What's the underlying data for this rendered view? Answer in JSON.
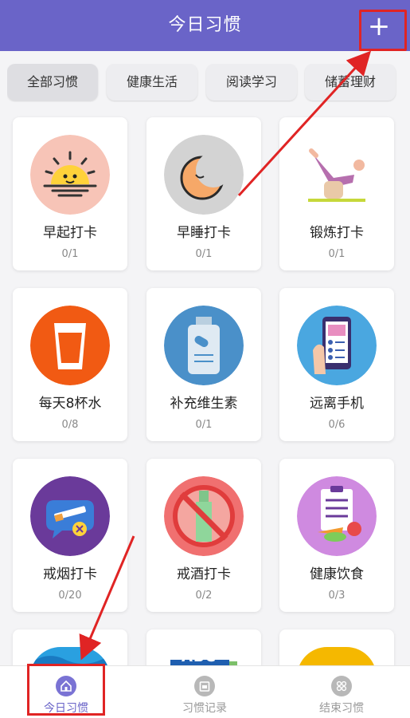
{
  "header": {
    "title": "今日习惯",
    "add_label": "+"
  },
  "tabs": [
    {
      "label": "全部习惯",
      "active": true
    },
    {
      "label": "健康生活",
      "active": false
    },
    {
      "label": "阅读学习",
      "active": false
    },
    {
      "label": "储蓄理财",
      "active": false
    }
  ],
  "habits": [
    {
      "name": "早起打卡",
      "progress": "0/1",
      "icon": "sunrise-icon",
      "color": "#f7c4b7"
    },
    {
      "name": "早睡打卡",
      "progress": "0/1",
      "icon": "moon-icon",
      "color": "#d3d3d3"
    },
    {
      "name": "锻炼打卡",
      "progress": "0/1",
      "icon": "yoga-icon",
      "color": "#ffffff"
    },
    {
      "name": "每天8杯水",
      "progress": "0/8",
      "icon": "water-glass-icon",
      "color": "#f15a13"
    },
    {
      "name": "补充维生素",
      "progress": "0/1",
      "icon": "vitamin-bottle-icon",
      "color": "#4a90c9"
    },
    {
      "name": "远离手机",
      "progress": "0/6",
      "icon": "phone-icon",
      "color": "#4aa7e0"
    },
    {
      "name": "戒烟打卡",
      "progress": "0/20",
      "icon": "no-smoking-icon",
      "color": "#6a3a9a"
    },
    {
      "name": "戒酒打卡",
      "progress": "0/2",
      "icon": "no-alcohol-icon",
      "color": "#f07070"
    },
    {
      "name": "健康饮食",
      "progress": "0/3",
      "icon": "healthy-food-icon",
      "color": "#cf8ae0"
    }
  ],
  "partial_row_icons": [
    "globe-icon",
    "abc-book-icon",
    "coin-icon"
  ],
  "bottom_nav": [
    {
      "label": "今日习惯",
      "icon": "home-icon",
      "active": true
    },
    {
      "label": "习惯记录",
      "icon": "calendar-icon",
      "active": false
    },
    {
      "label": "结束习惯",
      "icon": "grid-icon",
      "active": false
    }
  ],
  "colors": {
    "primary": "#6a64c8",
    "highlight": "#e02424"
  }
}
